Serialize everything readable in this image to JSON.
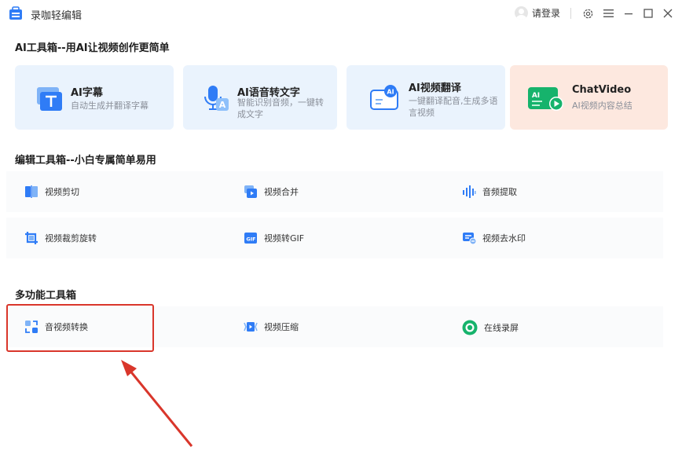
{
  "app": {
    "title": "录咖轻编辑",
    "login_label": "请登录"
  },
  "sections": {
    "ai": "AI工具箱--用AI让视频创作更简单",
    "edit": "编辑工具箱--小白专属简单易用",
    "multi": "多功能工具箱"
  },
  "ai_cards": [
    {
      "title": "AI字幕",
      "desc": "自动生成并翻译字幕",
      "icon": "subtitle-T-icon"
    },
    {
      "title": "AI语音转文字",
      "desc_l1": "智能识别音频，一键转",
      "desc_l2": "成文字",
      "icon": "microphone-icon"
    },
    {
      "title": "AI视频翻译",
      "desc_l1": "一键翻译配音,生成多语",
      "desc_l2": "言视频",
      "icon": "ai-translate-icon"
    },
    {
      "title": "ChatVideo",
      "desc": "AI视频内容总结",
      "icon": "ai-play-icon"
    }
  ],
  "edit_tools": [
    {
      "label": "视频剪切",
      "icon": "video-cut-icon"
    },
    {
      "label": "视频合并",
      "icon": "video-merge-icon"
    },
    {
      "label": "音频提取",
      "icon": "audio-extract-icon"
    },
    {
      "label": "视频裁剪旋转",
      "icon": "crop-rotate-icon"
    },
    {
      "label": "视频转GIF",
      "icon": "gif-icon"
    },
    {
      "label": "视频去水印",
      "icon": "remove-watermark-icon"
    }
  ],
  "multi_tools": [
    {
      "label": "音视频转换",
      "icon": "convert-icon"
    },
    {
      "label": "视频压缩",
      "icon": "compress-icon"
    },
    {
      "label": "在线录屏",
      "icon": "screen-record-icon"
    }
  ],
  "colors": {
    "accent": "#2f7cf6",
    "card_blue": "#eaf3fd",
    "card_peach": "#fde8df",
    "highlight": "#d9362b"
  }
}
